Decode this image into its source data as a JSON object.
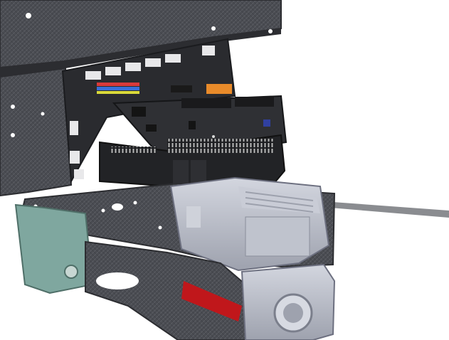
{
  "scene": {
    "subject": "cad-drone-frame-electronics-assembly",
    "background_color": "#ffffff",
    "colors": {
      "carbon_plate": "#4a4c52",
      "carbon_edge": "#2c2d31",
      "pcb_dark": "#2a2b2f",
      "connector_white": "#e8e8ea",
      "motor_housing": "#b9bdc9",
      "bracket_teal": "#7fa79f",
      "accent_red": "#c0171b",
      "orange_connector": "#e98b2a",
      "rail_gray": "#8a8c90"
    }
  }
}
